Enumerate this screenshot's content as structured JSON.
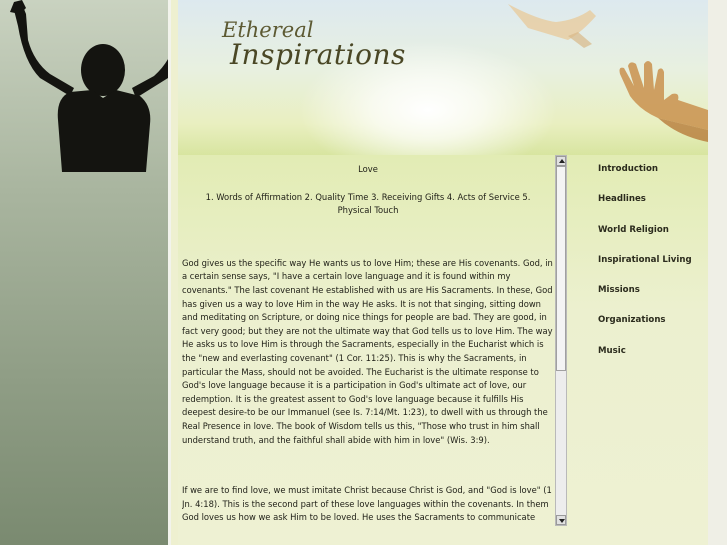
{
  "site": {
    "logo_top": "Ethereal",
    "logo_bottom": "Inspirations"
  },
  "nav": {
    "items": [
      {
        "label": "Introduction"
      },
      {
        "label": "Headlines"
      },
      {
        "label": "World Religion"
      },
      {
        "label": "Inspirational Living"
      },
      {
        "label": "Missions"
      },
      {
        "label": "Organizations"
      },
      {
        "label": "Music"
      }
    ]
  },
  "article": {
    "title": "Love",
    "languages": "1. Words of Affirmation 2. Quality Time 3. Receiving Gifts 4. Acts of Service 5. Physical Touch",
    "paragraph1": "God gives us the specific way He wants us to love Him; these are His covenants. God, in a certain sense says, \"I have a certain love language and it is found within my covenants.\" The last covenant He established with us are His Sacraments. In these, God has given us a way to love Him in the way He asks. It is not that singing, sitting down and meditating on Scripture, or doing nice things for people are bad. They are good, in fact very good; but they are not the ultimate way that God tells us to love Him. The way He asks us to love Him is through the Sacraments, especially in the Eucharist which is the \"new and everlasting covenant\" (1 Cor. 11:25). This is why the Sacraments, in particular the Mass, should not be avoided. The Eucharist is the ultimate response to God's love language because it is a participation in God's ultimate act of love, our redemption. It is the greatest assent to God's love language because it fulfills His deepest desire-to be our Immanuel (see Is. 7:14/Mt. 1:23), to dwell with us through the Real Presence in love. The book of Wisdom tells us this, \"Those who trust in him shall understand truth, and the faithful shall abide with him in love\" (Wis. 3:9).",
    "paragraph2": "If we are to find love, we must imitate Christ because Christ is God, and \"God is love\" (1 Jn. 4:18). This is the second part of these love languages within the covenants. In them God loves us how we ask Him to be loved. He uses the Sacraments to communicate each one of the five love languages. In the Sacraments, Jesus takes up the second love language by"
  },
  "scrollbar": {
    "position": 0
  }
}
